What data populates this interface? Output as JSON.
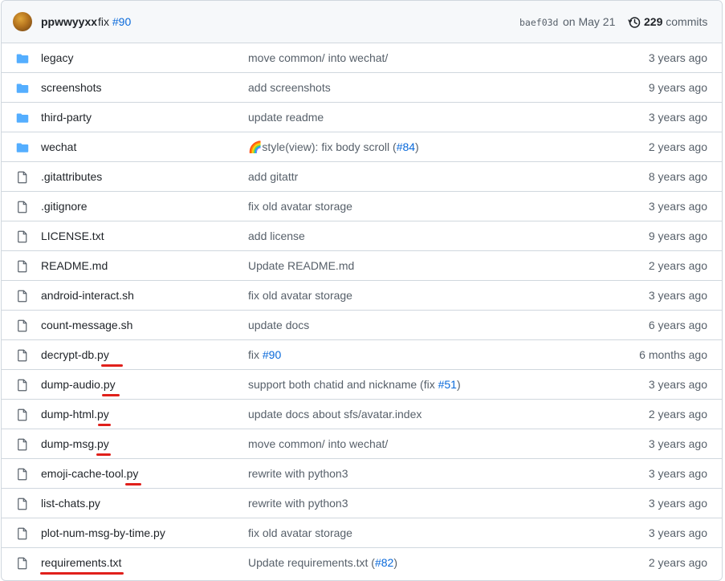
{
  "header": {
    "author": "ppwwyyxx",
    "commit_message": "fix",
    "commit_link": "#90",
    "sha": "baef03d",
    "date": "on May 21",
    "commit_count": "229",
    "commits_label": "commits"
  },
  "files": [
    {
      "type": "folder",
      "name": "legacy",
      "message": "move common/ into wechat/",
      "link": "",
      "suffix": "",
      "age": "3 years ago"
    },
    {
      "type": "folder",
      "name": "screenshots",
      "message": "add screenshots",
      "link": "",
      "suffix": "",
      "age": "9 years ago"
    },
    {
      "type": "folder",
      "name": "third-party",
      "message": "update readme",
      "link": "",
      "suffix": "",
      "age": "3 years ago"
    },
    {
      "type": "folder",
      "name": "wechat",
      "message": "🌈style(view): fix body scroll (",
      "link": "#84",
      "suffix": ")",
      "age": "2 years ago"
    },
    {
      "type": "file",
      "name": ".gitattributes",
      "message": "add gitattr",
      "link": "",
      "suffix": "",
      "age": "8 years ago"
    },
    {
      "type": "file",
      "name": ".gitignore",
      "message": "fix old avatar storage",
      "link": "",
      "suffix": "",
      "age": "3 years ago"
    },
    {
      "type": "file",
      "name": "LICENSE.txt",
      "message": "add license",
      "link": "",
      "suffix": "",
      "age": "9 years ago"
    },
    {
      "type": "file",
      "name": "README.md",
      "message": "Update README.md",
      "link": "",
      "suffix": "",
      "age": "2 years ago"
    },
    {
      "type": "file",
      "name": "android-interact.sh",
      "message": "fix old avatar storage",
      "link": "",
      "suffix": "",
      "age": "3 years ago"
    },
    {
      "type": "file",
      "name": "count-message.sh",
      "message": "update docs",
      "link": "",
      "suffix": "",
      "age": "6 years ago"
    },
    {
      "type": "file",
      "name": "decrypt-db.py",
      "message": "fix ",
      "link": "#90",
      "suffix": "",
      "age": "6 months ago"
    },
    {
      "type": "file",
      "name": "dump-audio.py",
      "message": "support both chatid and nickname (fix ",
      "link": "#51",
      "suffix": ")",
      "age": "3 years ago"
    },
    {
      "type": "file",
      "name": "dump-html.py",
      "message": "update docs about sfs/avatar.index",
      "link": "",
      "suffix": "",
      "age": "2 years ago"
    },
    {
      "type": "file",
      "name": "dump-msg.py",
      "message": "move common/ into wechat/",
      "link": "",
      "suffix": "",
      "age": "3 years ago"
    },
    {
      "type": "file",
      "name": "emoji-cache-tool.py",
      "message": "rewrite with python3",
      "link": "",
      "suffix": "",
      "age": "3 years ago"
    },
    {
      "type": "file",
      "name": "list-chats.py",
      "message": "rewrite with python3",
      "link": "",
      "suffix": "",
      "age": "3 years ago"
    },
    {
      "type": "file",
      "name": "plot-num-msg-by-time.py",
      "message": "fix old avatar storage",
      "link": "",
      "suffix": "",
      "age": "3 years ago"
    },
    {
      "type": "file",
      "name": "requirements.txt",
      "message": "Update requirements.txt (",
      "link": "#82",
      "suffix": ")",
      "age": "2 years ago"
    }
  ],
  "colors": {
    "folder_icon": "#54aeff",
    "file_icon": "#57606a",
    "link": "#0969da",
    "annotation_underline": "#e0201b"
  }
}
